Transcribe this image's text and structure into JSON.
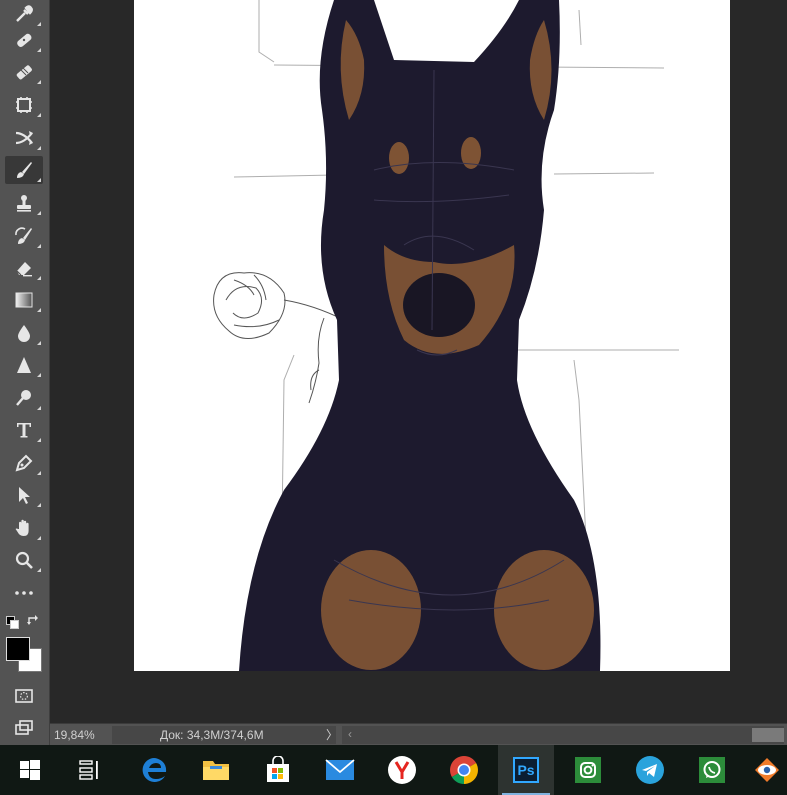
{
  "toolbar": {
    "tools": [
      {
        "name": "eyedropper-tool",
        "icon": "eyedropper-icon"
      },
      {
        "name": "spot-healing-tool",
        "icon": "bandage-icon"
      },
      {
        "name": "healing-brush-tool",
        "icon": "patch-icon"
      },
      {
        "name": "frame-tool",
        "icon": "frame-icon"
      },
      {
        "name": "content-aware-move-tool",
        "icon": "cross-arrows-icon"
      },
      {
        "name": "brush-tool",
        "icon": "brush-icon",
        "active": true
      },
      {
        "name": "clone-stamp-tool",
        "icon": "stamp-icon"
      },
      {
        "name": "history-brush-tool",
        "icon": "history-brush-icon"
      },
      {
        "name": "eraser-tool",
        "icon": "eraser-icon"
      },
      {
        "name": "gradient-tool",
        "icon": "gradient-icon"
      },
      {
        "name": "blur-tool",
        "icon": "drop-icon"
      },
      {
        "name": "sharpen-tool",
        "icon": "triangle-icon"
      },
      {
        "name": "dodge-tool",
        "icon": "dodge-icon"
      },
      {
        "name": "type-tool",
        "icon": "type-icon",
        "glyph": "T"
      },
      {
        "name": "pen-tool",
        "icon": "pen-icon"
      },
      {
        "name": "path-selection-tool",
        "icon": "arrow-icon"
      },
      {
        "name": "hand-tool",
        "icon": "hand-icon"
      },
      {
        "name": "zoom-tool",
        "icon": "magnifier-icon"
      },
      {
        "name": "more-tools",
        "icon": "ellipsis-icon",
        "glyph": "•••"
      }
    ],
    "foreground_color": "#000000",
    "background_color": "#ffffff"
  },
  "statusbar": {
    "zoom": "19,84%",
    "doc_info": "Док: 34,3M/374,6M",
    "arrow": "〉",
    "scroll_left": "‹"
  },
  "canvas": {
    "background": "#282828",
    "document_background": "#ffffff",
    "fur_color": "#1d1a2e",
    "tan_color": "#8a5a35"
  },
  "taskbar": {
    "items": [
      {
        "name": "start-button",
        "icon": "windows-icon"
      },
      {
        "name": "task-view-button",
        "icon": "task-view-icon"
      },
      {
        "name": "edge-button",
        "icon": "edge-icon"
      },
      {
        "name": "file-explorer-button",
        "icon": "folder-icon"
      },
      {
        "name": "store-button",
        "icon": "store-icon"
      },
      {
        "name": "mail-button",
        "icon": "mail-icon"
      },
      {
        "name": "yandex-browser-button",
        "icon": "yandex-icon"
      },
      {
        "name": "chrome-button",
        "icon": "chrome-icon"
      },
      {
        "name": "photoshop-button",
        "icon": "photoshop-icon",
        "label": "Ps",
        "active": true
      },
      {
        "name": "instagram-button",
        "icon": "instagram-icon"
      },
      {
        "name": "telegram-button",
        "icon": "telegram-icon"
      },
      {
        "name": "whatsapp-button",
        "icon": "whatsapp-icon"
      },
      {
        "name": "eye-app-button",
        "icon": "eye-icon"
      }
    ]
  }
}
